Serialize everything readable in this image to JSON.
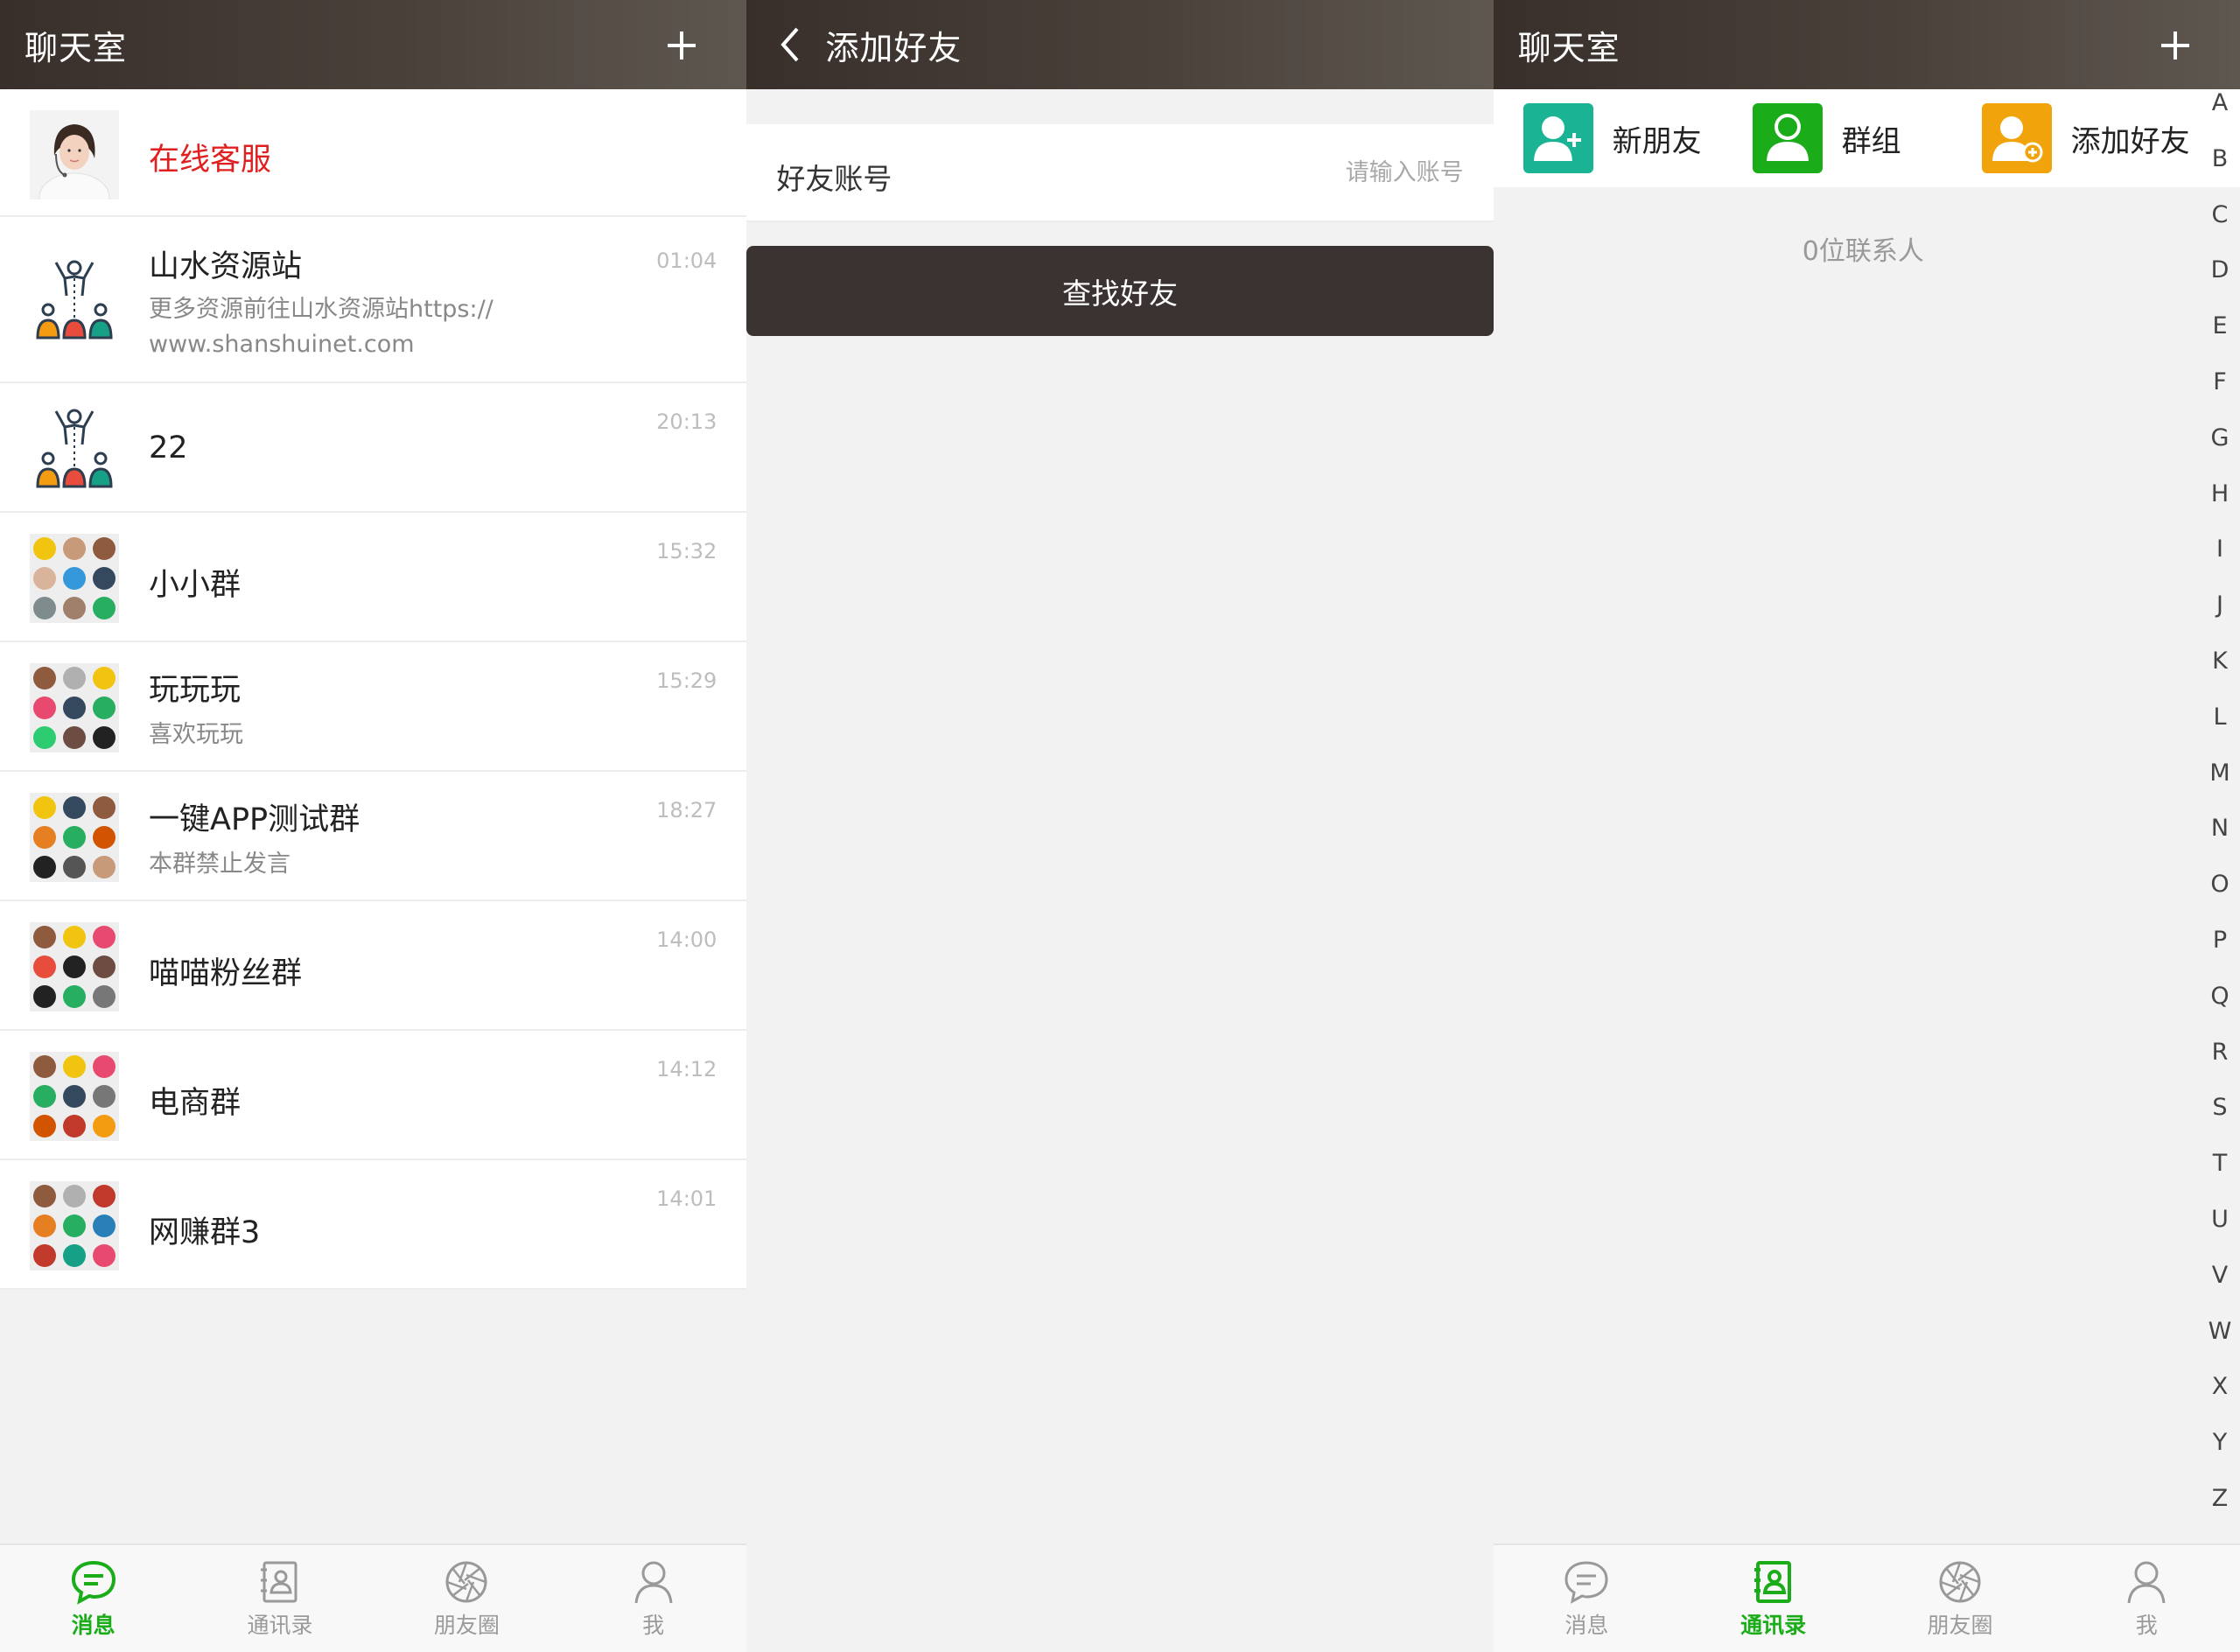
{
  "colors": {
    "navbar": "#3f3632",
    "accent_green": "#1aad19",
    "service_red": "#e02020",
    "search_button": "#3b3331"
  },
  "chat_panel": {
    "title": "聊天室",
    "plus_icon": "plus-icon",
    "service": {
      "name": "在线客服"
    },
    "chats": [
      {
        "name": "山水资源站",
        "time": "01:04",
        "preview_line1": "更多资源前往山水资源站https://",
        "preview_line2": "www.shanshuinet.com",
        "avatar": "people-tree-icon"
      },
      {
        "name": "22",
        "time": "20:13",
        "avatar": "people-tree-icon"
      },
      {
        "name": "小小群",
        "time": "15:32",
        "avatar": "group-grid-avatar"
      },
      {
        "name": "玩玩玩",
        "time": "15:29",
        "preview": "喜欢玩玩",
        "avatar": "group-grid-avatar"
      },
      {
        "name": "一键APP测试群",
        "time": "18:27",
        "preview": "本群禁止发言",
        "avatar": "group-grid-avatar"
      },
      {
        "name": "喵喵粉丝群",
        "time": "14:00",
        "avatar": "group-grid-avatar"
      },
      {
        "name": "电商群",
        "time": "14:12",
        "avatar": "group-grid-avatar"
      },
      {
        "name": "网赚群3",
        "time": "14:01",
        "avatar": "group-grid-avatar"
      }
    ],
    "tabs": [
      {
        "label": "消息",
        "icon": "chat-bubble-icon",
        "active": true
      },
      {
        "label": "通讯录",
        "icon": "contacts-book-icon",
        "active": false
      },
      {
        "label": "朋友圈",
        "icon": "aperture-icon",
        "active": false
      },
      {
        "label": "我",
        "icon": "person-icon",
        "active": false
      }
    ]
  },
  "add_friend_panel": {
    "title": "添加好友",
    "back_icon": "back-arrow-icon",
    "field_label": "好友账号",
    "field_placeholder": "请输入账号",
    "search_button": "查找好友"
  },
  "contacts_panel": {
    "title": "聊天室",
    "shortcuts": [
      {
        "label": "新朋友",
        "icon": "new-friend-icon",
        "color": "#1ab394"
      },
      {
        "label": "群组",
        "icon": "group-icon",
        "color": "#1aad19"
      },
      {
        "label": "添加好友",
        "icon": "add-friend-icon",
        "color": "#f0a30a"
      }
    ],
    "count_text": "0位联系人",
    "alphabet": [
      "A",
      "B",
      "C",
      "D",
      "E",
      "F",
      "G",
      "H",
      "I",
      "J",
      "K",
      "L",
      "M",
      "N",
      "O",
      "P",
      "Q",
      "R",
      "S",
      "T",
      "U",
      "V",
      "W",
      "X",
      "Y",
      "Z"
    ],
    "tabs": [
      {
        "label": "消息",
        "icon": "chat-bubble-icon",
        "active": false
      },
      {
        "label": "通讯录",
        "icon": "contacts-book-icon",
        "active": true
      },
      {
        "label": "朋友圈",
        "icon": "aperture-icon",
        "active": false
      },
      {
        "label": "我",
        "icon": "person-icon",
        "active": false
      }
    ]
  }
}
